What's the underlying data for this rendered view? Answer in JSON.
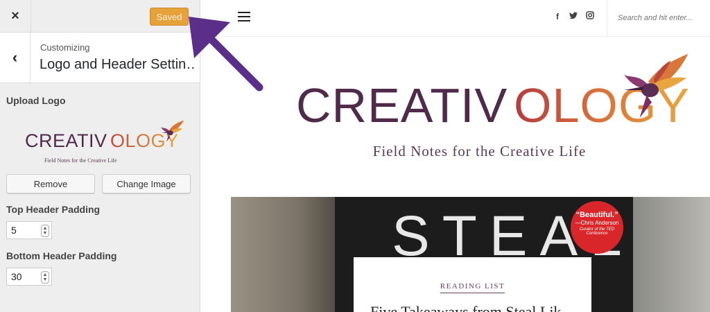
{
  "panel": {
    "close_icon": "×",
    "saved_label": "Saved",
    "back_icon": "‹",
    "customizing_label": "Customizing",
    "section_title": "Logo and Header Settin…",
    "upload_logo_label": "Upload Logo",
    "remove_label": "Remove",
    "change_image_label": "Change Image",
    "top_padding_label": "Top Header Padding",
    "top_padding_value": "5",
    "bottom_padding_label": "Bottom Header Padding",
    "bottom_padding_value": "30"
  },
  "logo": {
    "word_part1": "CREATIV",
    "word_part2": "OLOGY",
    "tagline": "Field Notes for the Creative Life",
    "colors": {
      "dark": "#4f2a4a",
      "orange": "#e4a43e",
      "red": "#c65a3c"
    }
  },
  "preview": {
    "search_placeholder": "Search and hit enter...",
    "social_icons": [
      "facebook-icon",
      "twitter-icon",
      "instagram-icon"
    ],
    "post_image_text": "STEAL",
    "badge_quote": "“Beautiful.”",
    "badge_author": "—Chris Anderson",
    "badge_sub": "Curator of the TED Conference",
    "card_category": "READING LIST",
    "card_title": "Five Takeaways from Steal Lik"
  },
  "colors": {
    "accent": "#e6a13a",
    "arrow": "#5b2e8a"
  }
}
